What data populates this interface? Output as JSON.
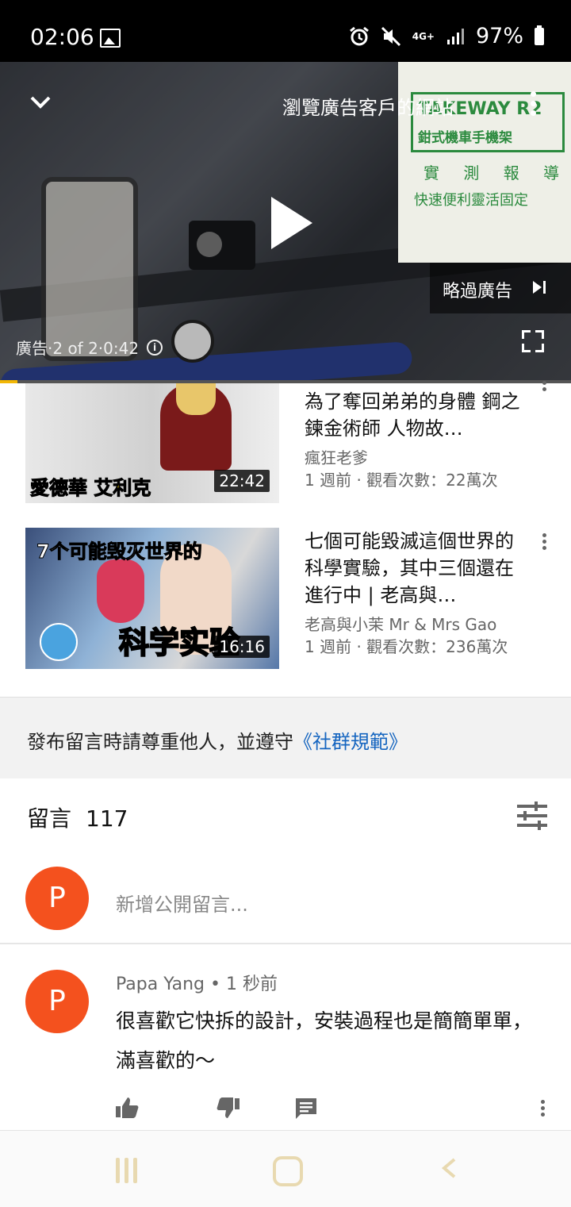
{
  "status_bar": {
    "time": "02:06",
    "network": "4G+",
    "battery": "97%",
    "icons": [
      "gallery-icon",
      "alarm-icon",
      "mute-icon",
      "signal-icon",
      "battery-icon"
    ]
  },
  "player": {
    "ad_link": "瀏覽廣告客戶的網站",
    "skip_label": "略過廣告",
    "ad_info": "廣告·2 of 2·0:42",
    "ad_progress": 0.03,
    "ad_panel": {
      "brand": "TAKEWAY R2",
      "product": "鉗式機車手機架",
      "report": "實 測 報 導",
      "tagline": "快速便利靈活固定"
    }
  },
  "recommendations": [
    {
      "title": "為了奪回弟弟的身體 鋼之鍊金術師 人物故…",
      "channel": "瘋狂老爹",
      "meta": "1 週前 · 觀看次數：22萬次",
      "duration": "22:42",
      "thumb_caption": "愛德華 艾利克"
    },
    {
      "title": "七個可能毀滅這個世界的科學實驗，其中三個還在進行中 | 老高與…",
      "channel": "老高與小茉 Mr & Mrs Gao",
      "meta": "1 週前 · 觀看次數：236萬次",
      "duration": "16:16",
      "thumb_caption_top": "7个可能毁灭世界的",
      "thumb_caption_bottom": "科学实验"
    }
  ],
  "guidelines": {
    "text": "發布留言時請尊重他人，並遵守",
    "link": "《社群規範》"
  },
  "comments": {
    "label": "留言",
    "count": "117",
    "add_placeholder": "新增公開留言...",
    "user_avatar_letter": "P",
    "items": [
      {
        "avatar_letter": "P",
        "author_line": "Papa Yang • 1 秒前",
        "text": "很喜歡它快拆的設計，安裝過程也是簡簡單單，滿喜歡的～"
      }
    ]
  },
  "colors": {
    "avatar": "#f4511e",
    "link": "#1565c0",
    "ad_progress": "#f2b705",
    "ad_brand": "#2b8a3e"
  }
}
